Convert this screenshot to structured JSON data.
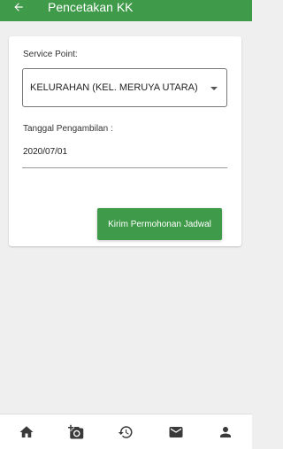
{
  "appbar": {
    "title": "Pencetakan KK"
  },
  "form": {
    "service_point_label": "Service Point:",
    "service_point_value": "KELURAHAN (KEL. MERUYA UTARA)",
    "date_label": "Tanggal Pengambilan :",
    "date_value": "2020/07/01",
    "submit_label": "Kirim Permohonan Jadwal"
  },
  "colors": {
    "primary": "#3f9a49",
    "background": "#efefef"
  },
  "bottom_nav": [
    {
      "icon": "home-icon"
    },
    {
      "icon": "add-photo-icon"
    },
    {
      "icon": "history-icon"
    },
    {
      "icon": "mail-icon"
    },
    {
      "icon": "person-icon"
    }
  ]
}
